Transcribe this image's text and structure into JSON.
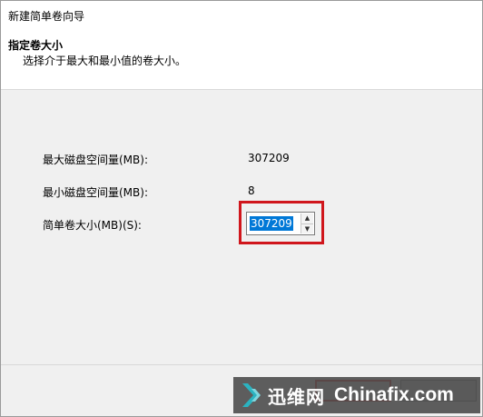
{
  "window": {
    "title": "新建简单卷向导"
  },
  "header": {
    "title": "指定卷大小",
    "subtitle": "选择介于最大和最小值的卷大小。"
  },
  "fields": {
    "max_label": "最大磁盘空间量(MB):",
    "max_value": "307209",
    "min_label": "最小磁盘空间量(MB):",
    "min_value": "8",
    "size_label": "简单卷大小(MB)(S):",
    "size_value": "307209"
  },
  "buttons": {
    "next": "",
    "cancel": ""
  },
  "watermark": {
    "cn": "迅维网",
    "en": "Chinafix.com"
  },
  "colors": {
    "highlight": "#d0161c",
    "selection": "#0078d7"
  },
  "icons": {
    "spin_up": "spin-up-arrow-icon",
    "spin_down": "spin-down-arrow-icon",
    "logo": "chevron-logo-icon"
  }
}
